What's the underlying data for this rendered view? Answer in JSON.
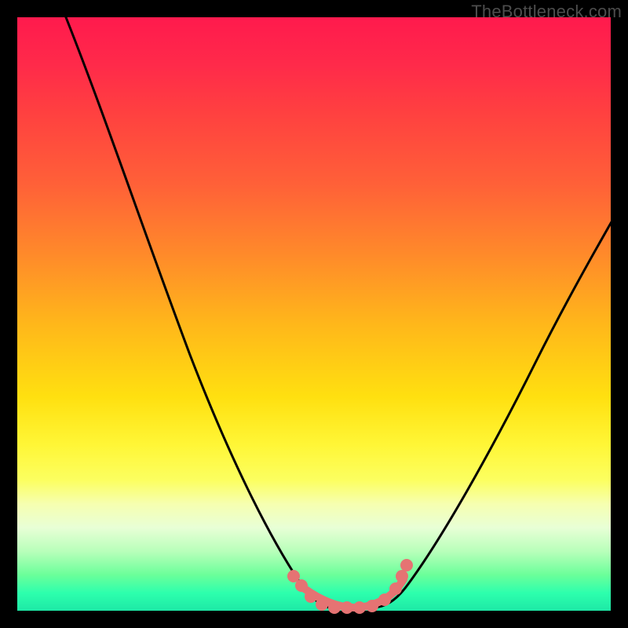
{
  "watermark": "TheBottleneck.com",
  "colors": {
    "background": "#000000",
    "gradient_top": "#ff1a4d",
    "gradient_bottom": "#1de9a6",
    "curve": "#000000",
    "marker": "#e57373"
  },
  "chart_data": {
    "type": "line",
    "title": "",
    "xlabel": "",
    "ylabel": "",
    "xlim": [
      0,
      100
    ],
    "ylim": [
      0,
      100
    ],
    "series": [
      {
        "name": "left-curve",
        "x": [
          8,
          12,
          16,
          20,
          25,
          30,
          35,
          40,
          45,
          48,
          50,
          52
        ],
        "values": [
          100,
          88,
          76,
          64,
          50,
          37,
          26,
          16,
          7,
          3,
          1,
          0
        ]
      },
      {
        "name": "right-curve",
        "x": [
          60,
          63,
          66,
          70,
          75,
          80,
          85,
          90,
          95,
          100
        ],
        "values": [
          0,
          1,
          3,
          7,
          14,
          24,
          35,
          47,
          58,
          68
        ]
      }
    ],
    "markers": {
      "name": "bottom-cluster",
      "points": [
        {
          "x": 46,
          "y": 5
        },
        {
          "x": 48,
          "y": 2
        },
        {
          "x": 50,
          "y": 1
        },
        {
          "x": 52,
          "y": 0.5
        },
        {
          "x": 54,
          "y": 0.5
        },
        {
          "x": 56,
          "y": 0.5
        },
        {
          "x": 58,
          "y": 0.5
        },
        {
          "x": 60,
          "y": 1
        },
        {
          "x": 62,
          "y": 3
        },
        {
          "x": 63,
          "y": 5
        },
        {
          "x": 64,
          "y": 7
        }
      ]
    }
  }
}
